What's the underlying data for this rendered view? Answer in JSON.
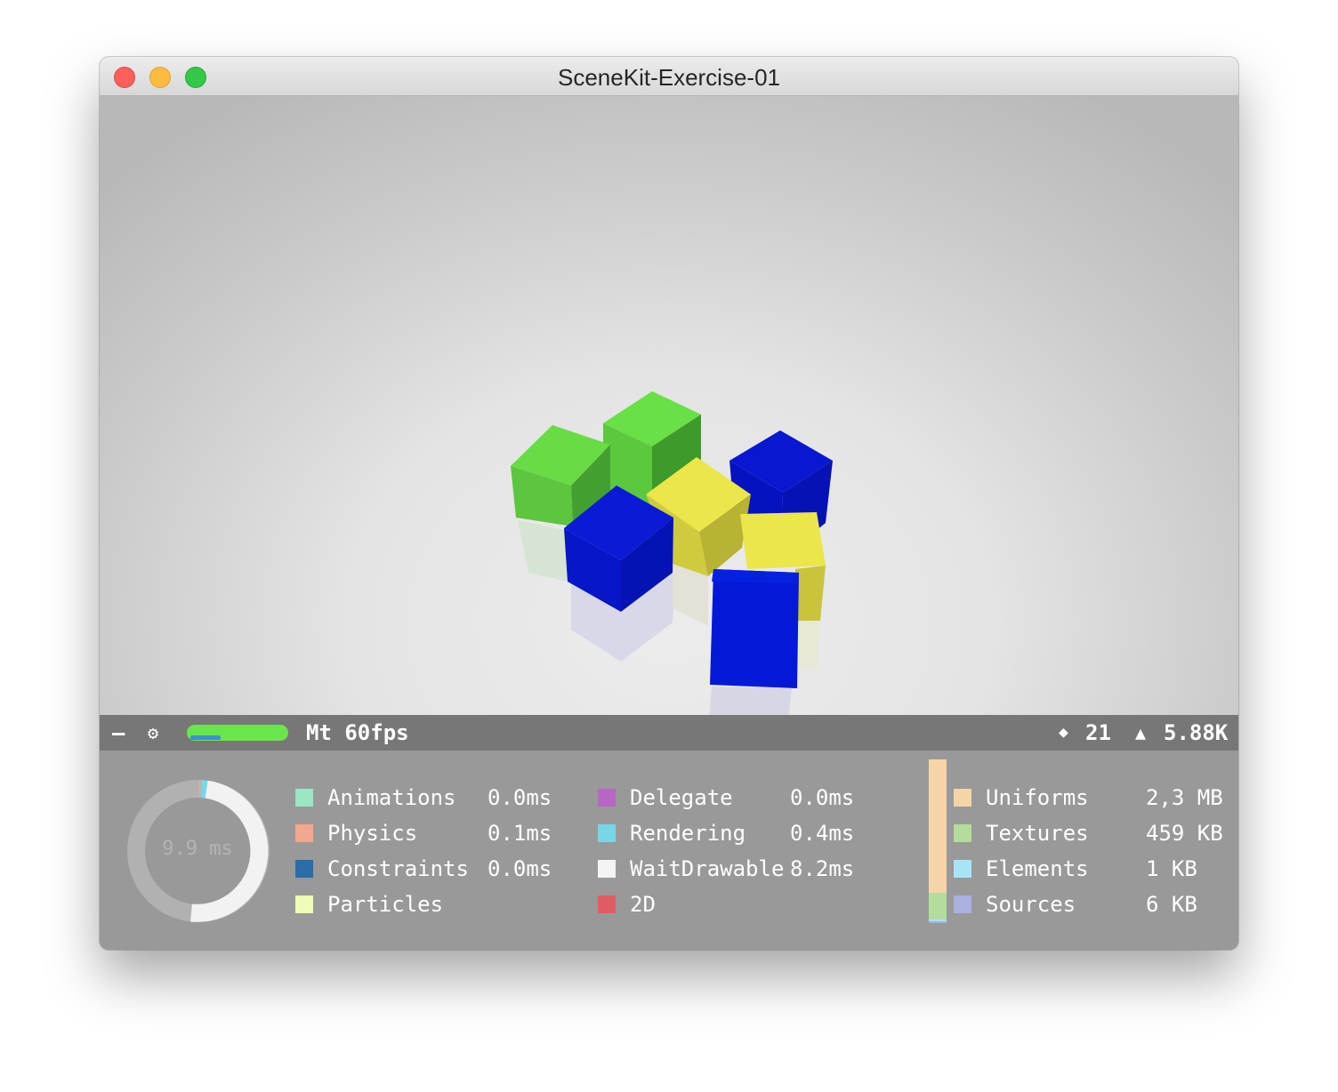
{
  "window": {
    "title": "SceneKit-Exercise-01"
  },
  "stats_bar": {
    "collapse_glyph": "–",
    "settings_glyph": "⚙",
    "fps_text": "Mt 60fps",
    "fps_level": 0.95,
    "nodes_glyph": "◆",
    "nodes": "21",
    "triangles_glyph": "▲",
    "triangles": "5.88K"
  },
  "frame_time": {
    "total": "9.9 ms",
    "timings": [
      {
        "label": "Animations",
        "value": "0.0ms",
        "color": "#9be6c3"
      },
      {
        "label": "Physics",
        "value": "0.1ms",
        "color": "#f0a890"
      },
      {
        "label": "Constraints",
        "value": "0.0ms",
        "color": "#2c6ca8"
      },
      {
        "label": "Particles",
        "value": "",
        "color": "#eefcb4"
      },
      {
        "label": "Delegate",
        "value": "0.0ms",
        "color": "#b766c3"
      },
      {
        "label": "Rendering",
        "value": "0.4ms",
        "color": "#78d7e6"
      },
      {
        "label": "WaitDrawable",
        "value": "8.2ms",
        "color": "#f4f4f4"
      },
      {
        "label": "2D",
        "value": "",
        "color": "#e05c64"
      }
    ]
  },
  "memory": [
    {
      "label": "Uniforms",
      "value": "2,3 MB",
      "color": "#f5d5a8"
    },
    {
      "label": "Textures",
      "value": "459 KB",
      "color": "#b4dc9c"
    },
    {
      "label": "Elements",
      "value": "1 KB",
      "color": "#a8e4f6"
    },
    {
      "label": "Sources",
      "value": "6 KB",
      "color": "#aab0e0"
    }
  ],
  "scene_colors": {
    "green": "#66e046",
    "yellow": "#e8e64a",
    "blue": "#0716d6"
  }
}
